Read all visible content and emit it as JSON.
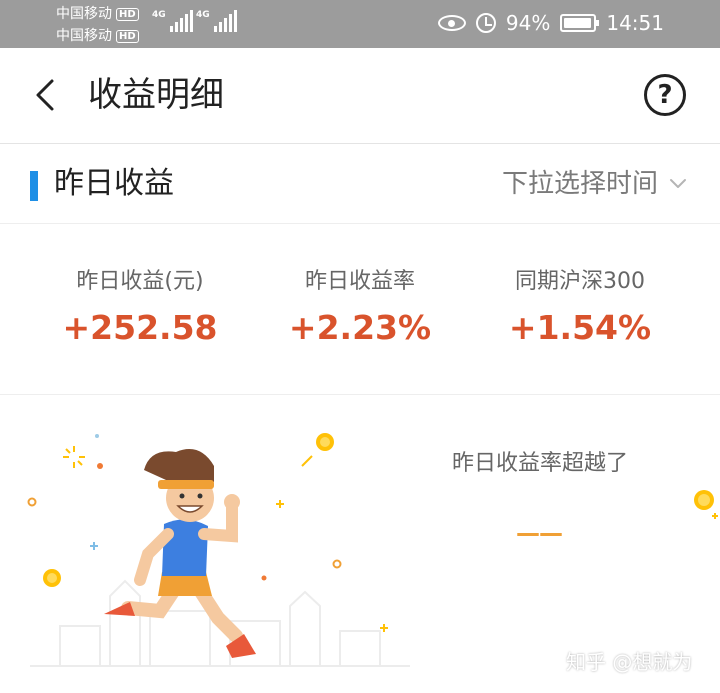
{
  "status_bar": {
    "carrier_1": "中国移动",
    "carrier_2": "中国移动",
    "hd_badge": "HD",
    "network_type": "4G",
    "battery": "94%",
    "time": "14:51",
    "icons": [
      "eye-icon",
      "alarm-icon",
      "battery-icon"
    ]
  },
  "header": {
    "title": "收益明细",
    "back_icon": "chevron-left-icon",
    "help_symbol": "?"
  },
  "section": {
    "title": "昨日收益",
    "dropdown_label": "下拉选择时间",
    "accent_color": "#1e8fe6"
  },
  "stats": [
    {
      "label": "昨日收益(元)",
      "value": "+252.58"
    },
    {
      "label": "昨日收益率",
      "value": "+2.23%"
    },
    {
      "label": "同期沪深300",
      "value": "+1.54%"
    }
  ],
  "beat": {
    "label": "昨日收益率超越了",
    "value": "——"
  },
  "watermark": "知乎 @想就为",
  "colors": {
    "value_red": "#d9532c",
    "placeholder_orange": "#f0a035",
    "coin_yellow": "#ffc107"
  }
}
